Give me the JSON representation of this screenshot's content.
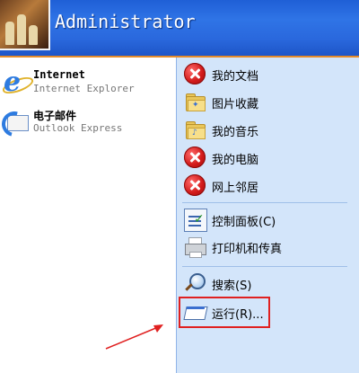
{
  "header": {
    "user_name": "Administrator"
  },
  "left_pane": {
    "pinned": [
      {
        "title": "Internet",
        "subtitle": "Internet Explorer",
        "icon": "internet-explorer-icon"
      },
      {
        "title": "电子邮件",
        "subtitle": "Outlook Express",
        "icon": "outlook-express-icon"
      }
    ]
  },
  "right_pane": {
    "places": [
      {
        "label": "我的文档",
        "icon": "red-x-icon"
      },
      {
        "label": "图片收藏",
        "icon": "folder-icon"
      },
      {
        "label": "我的音乐",
        "icon": "folder-icon"
      },
      {
        "label": "我的电脑",
        "icon": "red-x-icon"
      },
      {
        "label": "网上邻居",
        "icon": "red-x-icon"
      }
    ],
    "settings": [
      {
        "label": "控制面板(C)",
        "icon": "control-panel-icon"
      },
      {
        "label": "打印机和传真",
        "icon": "printer-icon"
      }
    ],
    "tools": [
      {
        "label": "搜索(S)",
        "icon": "search-icon"
      },
      {
        "label": "运行(R)...",
        "icon": "run-icon"
      }
    ]
  },
  "colors": {
    "header_blue": "#2a68dd",
    "right_pane_bg": "#d3e5fa",
    "highlight_red": "#e02020"
  }
}
